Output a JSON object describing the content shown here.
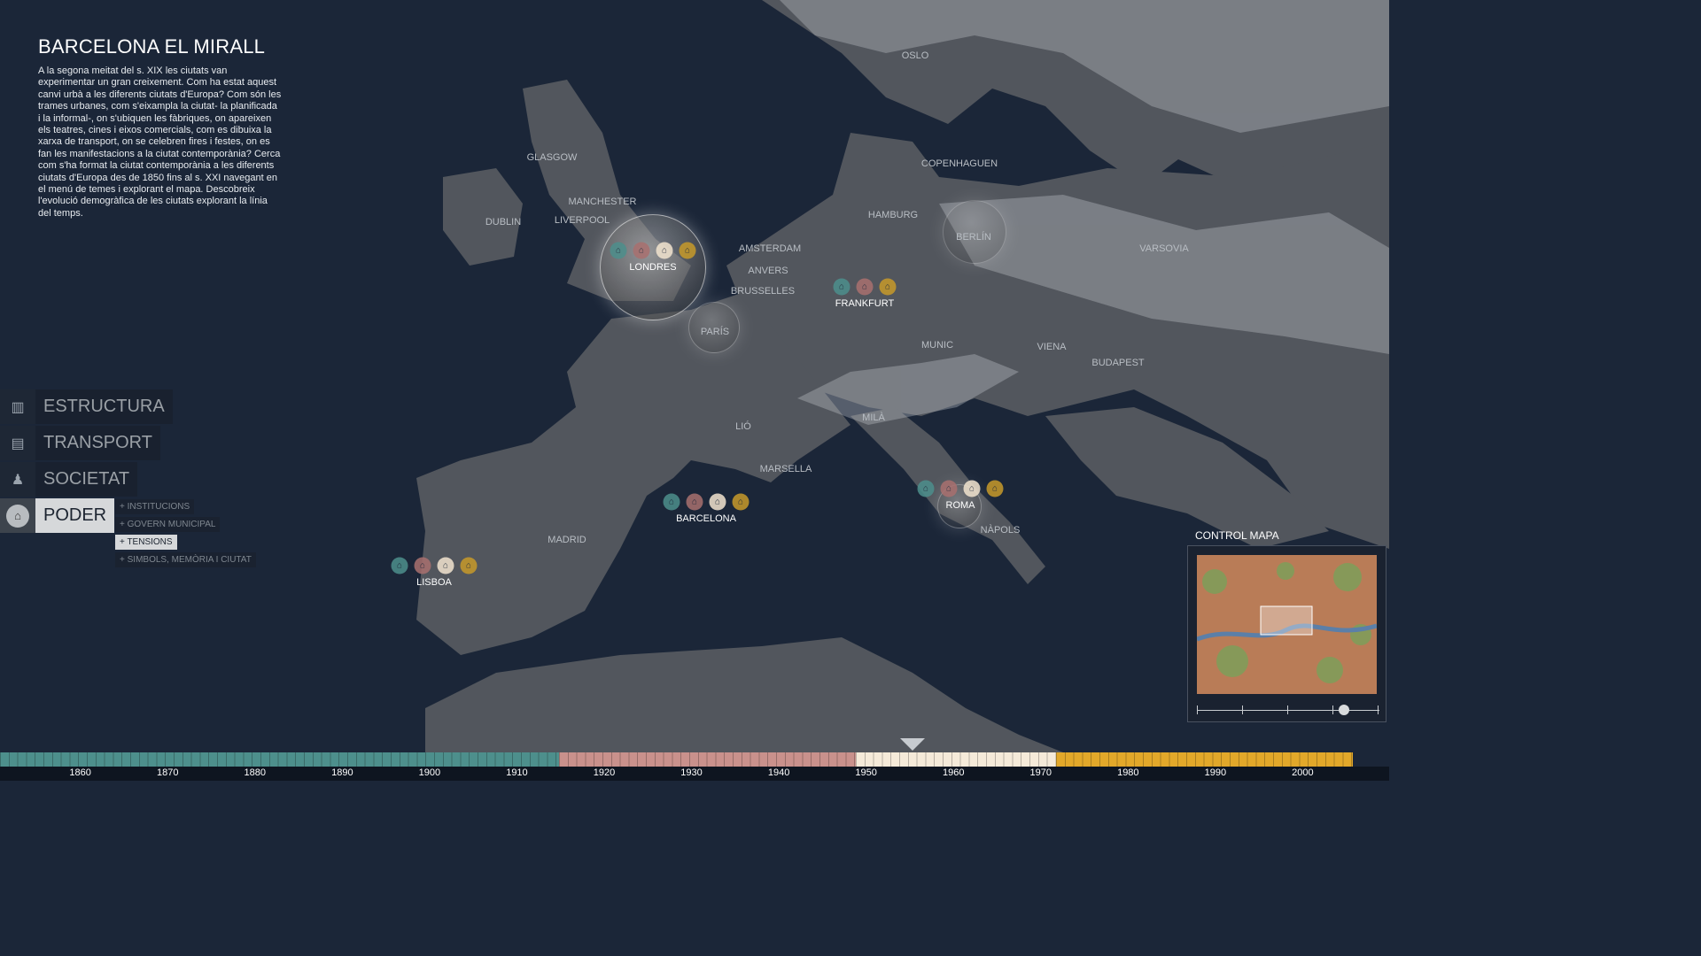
{
  "app": {
    "title": "BARCELONA EL MIRALL",
    "intro": "A la segona meitat del s. XIX les ciutats van experimentar un gran creixement. Com ha estat aquest canvi urbà a les diferents ciutats d'Europa? Com són les trames urbanes, com s'eixampla la ciutat- la planificada i la informal-, on s'ubiquen les fàbriques, on apareixen els teatres, cines i eixos comercials, com es dibuixa la xarxa de transport, on se celebren fires i festes, on es fan les manifestacions a la ciutat contemporània? Cerca com s'ha format la ciutat contemporània a les diferents ciutats d'Europa des de 1850 fins al s. XXI navegant en el menú de temes i explorant el mapa. Descobreix l'evolució demogràfica de les ciutats explorant la línia del temps."
  },
  "map": {
    "cities": [
      "OSLO",
      "GLASGOW",
      "COPENHAGUEN",
      "MANCHESTER",
      "HAMBURG",
      "DUBLIN",
      "LIVERPOOL",
      "BERLÍN",
      "VARSOVIA",
      "LONDRES",
      "AMSTERDAM",
      "ANVERS",
      "BRUSSELLES",
      "FRANKFURT",
      "PARÍS",
      "MUNIC",
      "VIENA",
      "BUDAPEST",
      "MILÀ",
      "LIÓ",
      "MARSELLA",
      "ROMA",
      "BARCELONA",
      "NÀPOLS",
      "MADRID",
      "LISBOA"
    ],
    "active_cities": [
      "LONDRES",
      "FRANKFURT",
      "ROMA",
      "BARCELONA",
      "LISBOA"
    ],
    "colors": {
      "sea": "#1b2638",
      "land": "#5b6068",
      "snow": "#c5c9cf"
    }
  },
  "menu": {
    "items": [
      {
        "label": "ESTRUCTURA",
        "icon": "building-icon"
      },
      {
        "label": "TRANSPORT",
        "icon": "tram-icon"
      },
      {
        "label": "SOCIETAT",
        "icon": "people-icon"
      },
      {
        "label": "PODER",
        "icon": "government-icon",
        "active": true
      }
    ],
    "submenu": [
      "+ INSTITUCIONS",
      "+ GOVERN MUNICIPAL",
      "+ TENSIONS",
      "+ SIMBOLS, MEMÒRIA I CIUTAT"
    ],
    "submenu_active": "+ TENSIONS"
  },
  "control": {
    "title": "CONTROL MAPA",
    "slider_value": 0.8
  },
  "timeline": {
    "years": [
      "1860",
      "1870",
      "1880",
      "1890",
      "1900",
      "1910",
      "1920",
      "1930",
      "1940",
      "1950",
      "1960",
      "1970",
      "1980",
      "1990",
      "2000"
    ],
    "periods": [
      {
        "from": 1855,
        "to": 1919,
        "color": "#4d8f8c"
      },
      {
        "from": 1919,
        "to": 1953,
        "color": "#c9918c"
      },
      {
        "from": 1953,
        "to": 1976,
        "color": "#f5ead9"
      },
      {
        "from": 1976,
        "to": 2010,
        "color": "#e2a82a"
      }
    ]
  }
}
